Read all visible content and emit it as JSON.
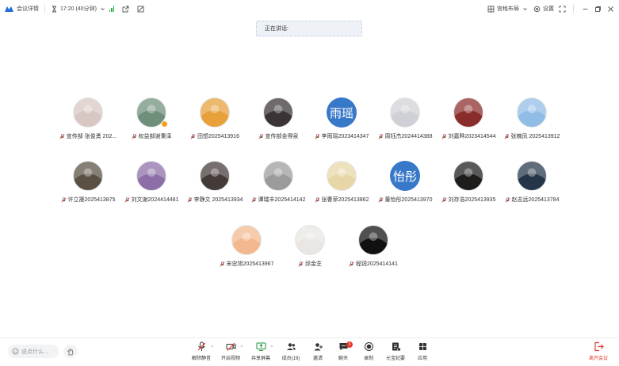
{
  "topbar": {
    "meeting_details": "会议详情",
    "time": "17:20 (40分钟)",
    "grid_layout": "宫格布局",
    "settings": "设置"
  },
  "speaking_label": "正在讲话:",
  "participants": [
    {
      "name": "宣传部 张俊勇 202...",
      "avatar": "photo",
      "color": "#d8c7c2"
    },
    {
      "name": "权益部谢秉泽",
      "avatar": "photo",
      "color": "#6f8f7a",
      "host": true
    },
    {
      "name": "田想2025413916",
      "avatar": "photo",
      "color": "#e7a03a"
    },
    {
      "name": "宣传部金得泉",
      "avatar": "photo",
      "color": "#3a3436"
    },
    {
      "name": "李雨瑶2023414347",
      "avatar": "text",
      "text": "雨瑶",
      "color": "#3878c8"
    },
    {
      "name": "周钰杰2024414388",
      "avatar": "photo",
      "color": "#cfcfd6"
    },
    {
      "name": "刘嘉晔2023414544",
      "avatar": "photo",
      "color": "#8a2c2a"
    },
    {
      "name": "张楠凤 2025413912",
      "avatar": "photo",
      "color": "#8fbde6"
    },
    {
      "name": "许立晟2025413875",
      "avatar": "photo",
      "color": "#5a5044"
    },
    {
      "name": "刘文谢2024414481",
      "avatar": "photo",
      "color": "#8d6ea8"
    },
    {
      "name": "李静文 2025413934",
      "avatar": "photo",
      "color": "#443a38"
    },
    {
      "name": "谭瑞丰2025414142",
      "avatar": "photo",
      "color": "#9b9b9b"
    },
    {
      "name": "张曹菲2025413862",
      "avatar": "photo",
      "color": "#e8d7a6"
    },
    {
      "name": "董怡彤2025413970",
      "avatar": "text",
      "text": "怡彤",
      "color": "#3878c8"
    },
    {
      "name": "刘存浩2025413935",
      "avatar": "photo",
      "color": "#1e1d1c"
    },
    {
      "name": "赵志远2025413784",
      "avatar": "photo",
      "color": "#25364a"
    },
    {
      "name": "宋忠旭2025413967",
      "avatar": "photo",
      "color": "#f3b88e"
    },
    {
      "name": "邱金芝",
      "avatar": "photo",
      "color": "#e9e6e3"
    },
    {
      "name": "程锐2025414141",
      "avatar": "photo",
      "color": "#111111"
    }
  ],
  "chat_placeholder": "说点什么...",
  "toolbar": {
    "unmute": "解除静音",
    "video": "开启视频",
    "share": "共享屏幕",
    "members": "成员(19)",
    "invite": "邀请",
    "chat": "聊天",
    "chat_badge": "1",
    "record": "录制",
    "minutes": "元宝纪要",
    "apps": "应用",
    "leave": "离开会议"
  },
  "colors": {
    "accent": "#3878c8",
    "danger": "#e53b2c",
    "signal": "#2db34a"
  }
}
